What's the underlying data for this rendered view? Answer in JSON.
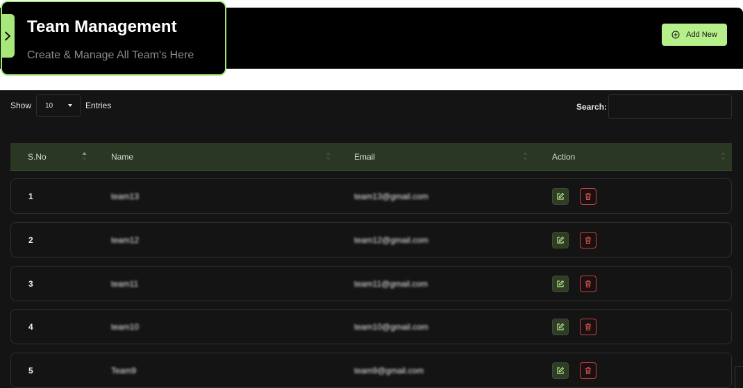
{
  "header": {
    "title": "Team Management",
    "subtitle": "Create & Manage All Team's Here",
    "add_button_label": "Add New"
  },
  "controls": {
    "show_label": "Show",
    "entries_value": "10",
    "entries_label": "Entries",
    "search_label": "Search:",
    "search_value": ""
  },
  "table": {
    "columns": [
      "S.No",
      "Name",
      "Email",
      "Action"
    ],
    "rows": [
      {
        "sno": "1",
        "name": "team13",
        "email": "team13@gmail.com"
      },
      {
        "sno": "2",
        "name": "team12",
        "email": "team12@gmail.com"
      },
      {
        "sno": "3",
        "name": "team11",
        "email": "team11@gmail.com"
      },
      {
        "sno": "4",
        "name": "team10",
        "email": "team10@gmail.com"
      },
      {
        "sno": "5",
        "name": "Team9",
        "email": "team9@gmail.com"
      }
    ]
  },
  "icons": {
    "sidebar_toggle": "chevron-right-icon",
    "add": "plus-circle-icon",
    "entries_caret": "caret-down-icon",
    "sort": "sort-icon",
    "edit": "edit-icon",
    "delete": "trash-icon"
  },
  "colors": {
    "accent": "#a6e87a",
    "button": "#b5f08b",
    "header_row": "#2a3722",
    "delete": "#c44646",
    "background": "#141414"
  }
}
